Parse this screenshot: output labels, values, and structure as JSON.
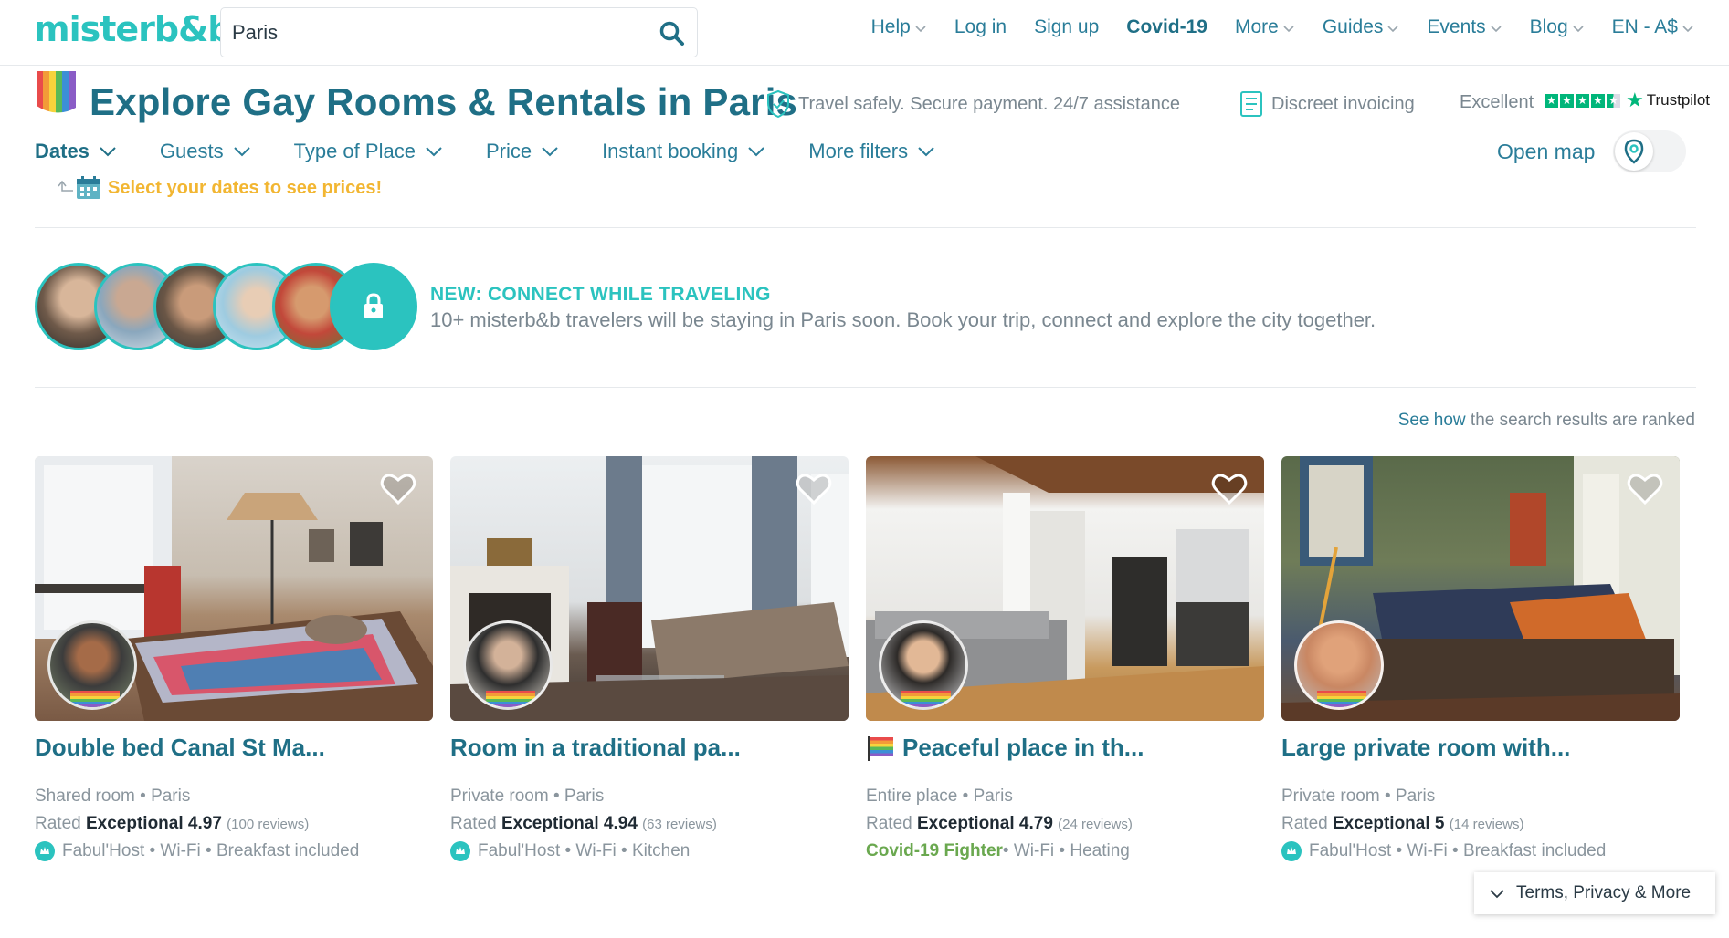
{
  "brand": {
    "logo_text": "misterb&b",
    "accent": "#2bc3bf",
    "primary_text": "#1f6f86",
    "link": "#2a7d99",
    "warning": "#f2b632"
  },
  "search": {
    "value": "Paris",
    "placeholder": ""
  },
  "nav": {
    "help": "Help",
    "login": "Log in",
    "signup": "Sign up",
    "covid": "Covid-19",
    "more": "More",
    "guides": "Guides",
    "events": "Events",
    "blog": "Blog",
    "locale": "EN - A$"
  },
  "header": {
    "title": "Explore Gay Rooms & Rentals in Paris",
    "trust_safety": "Travel safely. Secure payment. 24/7 assistance",
    "trust_invoice": "Discreet invoicing",
    "trustpilot_rating": "Excellent",
    "trustpilot_stars": 4.5,
    "trustpilot_brand": "Trustpilot"
  },
  "filters": {
    "dates": "Dates",
    "guests": "Guests",
    "type": "Type of Place",
    "price": "Price",
    "instant": "Instant booking",
    "more": "More filters",
    "open_map": "Open map",
    "date_hint": "Select your dates to see prices!"
  },
  "connect": {
    "title": "NEW: CONNECT WHILE TRAVELING",
    "text": "10+ misterb&b travelers will be staying in Paris soon. Book your trip, connect and explore the city together."
  },
  "ranking": {
    "link": "See how",
    "text": " the search results are ranked"
  },
  "listings": [
    {
      "title": "Double bed Canal St Ma...",
      "type": "Shared room",
      "city": "Paris",
      "rated": "Rated ",
      "rating_label": "Exceptional 4.97",
      "reviews": "(100 reviews)",
      "amenities": "Fabul'Host • Wi-Fi • Breakfast included",
      "host_badge": "fabulhost"
    },
    {
      "title": "Room in a traditional pa...",
      "type": "Private room",
      "city": "Paris",
      "rated": "Rated ",
      "rating_label": "Exceptional 4.94",
      "reviews": "(63 reviews)",
      "amenities": "Fabul'Host • Wi-Fi • Kitchen",
      "host_badge": "fabulhost"
    },
    {
      "title": "Peaceful place in th...",
      "type": "Entire place",
      "city": "Paris",
      "rated": "Rated ",
      "rating_label": "Exceptional 4.79",
      "reviews": "(24 reviews)",
      "covid_badge": "Covid-19 Fighter",
      "amenities": " • Wi-Fi • Heating",
      "host_badge": "rainbow-flag"
    },
    {
      "title": "Large private room with...",
      "type": "Private room",
      "city": "Paris",
      "rated": "Rated ",
      "rating_label": "Exceptional 5",
      "reviews": "(14 reviews)",
      "amenities": "Fabul'Host • Wi-Fi • Breakfast included",
      "host_badge": "fabulhost"
    }
  ],
  "footer": {
    "terms": "Terms, Privacy & More"
  }
}
